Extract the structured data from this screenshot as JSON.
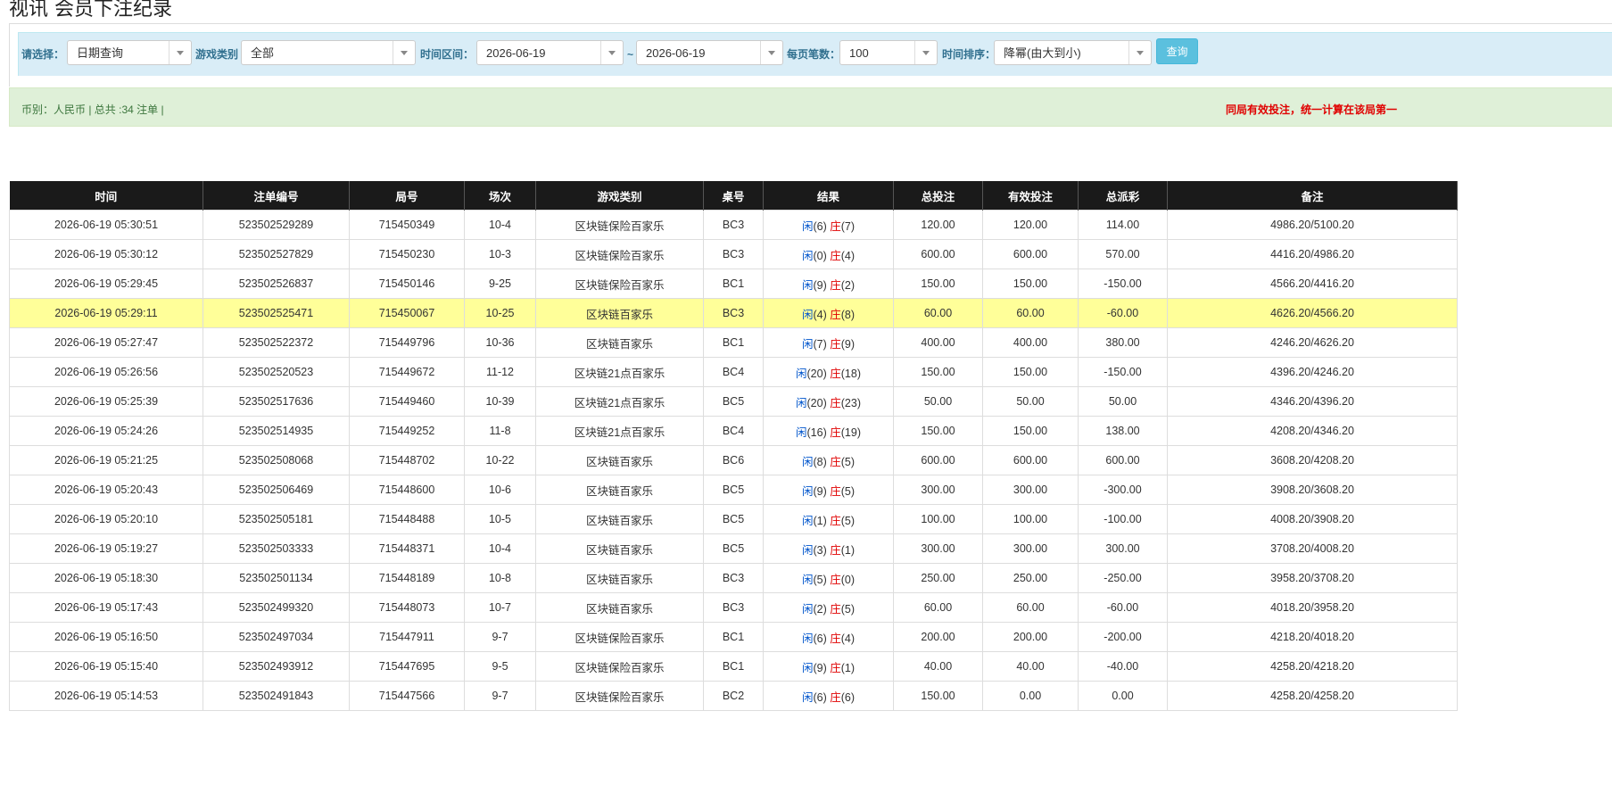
{
  "page_title": "视讯 会员下注纪录",
  "filters": {
    "select_label": "请选择：",
    "select_value": "日期查询",
    "game_type_label": "游戏类别",
    "game_type_value": "全部",
    "time_range_label": "时间区间：",
    "date_from": "2026-06-19",
    "tilde": "~",
    "date_to": "2026-06-19",
    "per_page_label": "每页笔数：",
    "per_page_value": "100",
    "sort_label": "时间排序：",
    "sort_value": "降幂(由大到小)",
    "query_button": "查询"
  },
  "summary": {
    "text": "币别：人民币 | 总共 :34 注单 |",
    "note": "同局有效投注，统一计算在该局第一"
  },
  "colors": {
    "header_bg": "#1a1a1a",
    "filter_bg": "#d9edf7",
    "summary_bg": "#dff0d8",
    "highlight_row": "#ffff99",
    "blue_amount": "#0066dd",
    "red_amount": "#e00000",
    "query_button": "#5bc0de"
  },
  "table": {
    "headers": [
      "时间",
      "注单编号",
      "局号",
      "场次",
      "游戏类别",
      "桌号",
      "结果",
      "总投注",
      "有效投注",
      "总派彩",
      "备注"
    ],
    "result_player_label": "闲",
    "result_banker_label": "庄",
    "rows": [
      {
        "time": "2026-06-19 05:30:51",
        "bet_no": "523502529289",
        "round": "715450349",
        "session": "10-4",
        "game": "区块链保险百家乐",
        "table": "BC3",
        "p": "(6)",
        "b": "(7)",
        "total": "120.00",
        "valid": "120.00",
        "payout": "114.00",
        "payout_neg": false,
        "note": "4986.20/5100.20",
        "highlight": false
      },
      {
        "time": "2026-06-19 05:30:12",
        "bet_no": "523502527829",
        "round": "715450230",
        "session": "10-3",
        "game": "区块链保险百家乐",
        "table": "BC3",
        "p": "(0)",
        "b": "(4)",
        "total": "600.00",
        "valid": "600.00",
        "payout": "570.00",
        "payout_neg": false,
        "note": "4416.20/4986.20",
        "highlight": false
      },
      {
        "time": "2026-06-19 05:29:45",
        "bet_no": "523502526837",
        "round": "715450146",
        "session": "9-25",
        "game": "区块链保险百家乐",
        "table": "BC1",
        "p": "(9)",
        "b": "(2)",
        "total": "150.00",
        "valid": "150.00",
        "payout": "-150.00",
        "payout_neg": true,
        "note": "4566.20/4416.20",
        "highlight": false
      },
      {
        "time": "2026-06-19 05:29:11",
        "bet_no": "523502525471",
        "round": "715450067",
        "session": "10-25",
        "game": "区块链百家乐",
        "table": "BC3",
        "p": "(4)",
        "b": "(8)",
        "total": "60.00",
        "valid": "60.00",
        "payout": "-60.00",
        "payout_neg": true,
        "note": "4626.20/4566.20",
        "highlight": true
      },
      {
        "time": "2026-06-19 05:27:47",
        "bet_no": "523502522372",
        "round": "715449796",
        "session": "10-36",
        "game": "区块链百家乐",
        "table": "BC1",
        "p": "(7)",
        "b": "(9)",
        "total": "400.00",
        "valid": "400.00",
        "payout": "380.00",
        "payout_neg": false,
        "note": "4246.20/4626.20",
        "highlight": false
      },
      {
        "time": "2026-06-19 05:26:56",
        "bet_no": "523502520523",
        "round": "715449672",
        "session": "11-12",
        "game": "区块链21点百家乐",
        "table": "BC4",
        "p": "(20)",
        "b": "(18)",
        "total": "150.00",
        "valid": "150.00",
        "payout": "-150.00",
        "payout_neg": true,
        "note": "4396.20/4246.20",
        "highlight": false
      },
      {
        "time": "2026-06-19 05:25:39",
        "bet_no": "523502517636",
        "round": "715449460",
        "session": "10-39",
        "game": "区块链21点百家乐",
        "table": "BC5",
        "p": "(20)",
        "b": "(23)",
        "total": "50.00",
        "valid": "50.00",
        "payout": "50.00",
        "payout_neg": false,
        "note": "4346.20/4396.20",
        "highlight": false
      },
      {
        "time": "2026-06-19 05:24:26",
        "bet_no": "523502514935",
        "round": "715449252",
        "session": "11-8",
        "game": "区块链21点百家乐",
        "table": "BC4",
        "p": "(16)",
        "b": "(19)",
        "total": "150.00",
        "valid": "150.00",
        "payout": "138.00",
        "payout_neg": false,
        "note": "4208.20/4346.20",
        "highlight": false
      },
      {
        "time": "2026-06-19 05:21:25",
        "bet_no": "523502508068",
        "round": "715448702",
        "session": "10-22",
        "game": "区块链百家乐",
        "table": "BC6",
        "p": "(8)",
        "b": "(5)",
        "total": "600.00",
        "valid": "600.00",
        "payout": "600.00",
        "payout_neg": false,
        "note": "3608.20/4208.20",
        "highlight": false
      },
      {
        "time": "2026-06-19 05:20:43",
        "bet_no": "523502506469",
        "round": "715448600",
        "session": "10-6",
        "game": "区块链百家乐",
        "table": "BC5",
        "p": "(9)",
        "b": "(5)",
        "total": "300.00",
        "valid": "300.00",
        "payout": "-300.00",
        "payout_neg": true,
        "note": "3908.20/3608.20",
        "highlight": false
      },
      {
        "time": "2026-06-19 05:20:10",
        "bet_no": "523502505181",
        "round": "715448488",
        "session": "10-5",
        "game": "区块链百家乐",
        "table": "BC5",
        "p": "(1)",
        "b": "(5)",
        "total": "100.00",
        "valid": "100.00",
        "payout": "-100.00",
        "payout_neg": true,
        "note": "4008.20/3908.20",
        "highlight": false
      },
      {
        "time": "2026-06-19 05:19:27",
        "bet_no": "523502503333",
        "round": "715448371",
        "session": "10-4",
        "game": "区块链百家乐",
        "table": "BC5",
        "p": "(3)",
        "b": "(1)",
        "total": "300.00",
        "valid": "300.00",
        "payout": "300.00",
        "payout_neg": false,
        "note": "3708.20/4008.20",
        "highlight": false
      },
      {
        "time": "2026-06-19 05:18:30",
        "bet_no": "523502501134",
        "round": "715448189",
        "session": "10-8",
        "game": "区块链百家乐",
        "table": "BC3",
        "p": "(5)",
        "b": "(0)",
        "total": "250.00",
        "valid": "250.00",
        "payout": "-250.00",
        "payout_neg": true,
        "note": "3958.20/3708.20",
        "highlight": false
      },
      {
        "time": "2026-06-19 05:17:43",
        "bet_no": "523502499320",
        "round": "715448073",
        "session": "10-7",
        "game": "区块链百家乐",
        "table": "BC3",
        "p": "(2)",
        "b": "(5)",
        "total": "60.00",
        "valid": "60.00",
        "payout": "-60.00",
        "payout_neg": true,
        "note": "4018.20/3958.20",
        "highlight": false
      },
      {
        "time": "2026-06-19 05:16:50",
        "bet_no": "523502497034",
        "round": "715447911",
        "session": "9-7",
        "game": "区块链保险百家乐",
        "table": "BC1",
        "p": "(6)",
        "b": "(4)",
        "total": "200.00",
        "valid": "200.00",
        "payout": "-200.00",
        "payout_neg": true,
        "note": "4218.20/4018.20",
        "highlight": false
      },
      {
        "time": "2026-06-19 05:15:40",
        "bet_no": "523502493912",
        "round": "715447695",
        "session": "9-5",
        "game": "区块链保险百家乐",
        "table": "BC1",
        "p": "(9)",
        "b": "(1)",
        "total": "40.00",
        "valid": "40.00",
        "payout": "-40.00",
        "payout_neg": true,
        "note": "4258.20/4218.20",
        "highlight": false
      },
      {
        "time": "2026-06-19 05:14:53",
        "bet_no": "523502491843",
        "round": "715447566",
        "session": "9-7",
        "game": "区块链保险百家乐",
        "table": "BC2",
        "p": "(6)",
        "b": "(6)",
        "total": "150.00",
        "valid": "0.00",
        "payout": "0.00",
        "payout_neg": false,
        "note": "4258.20/4258.20",
        "highlight": false
      }
    ]
  }
}
